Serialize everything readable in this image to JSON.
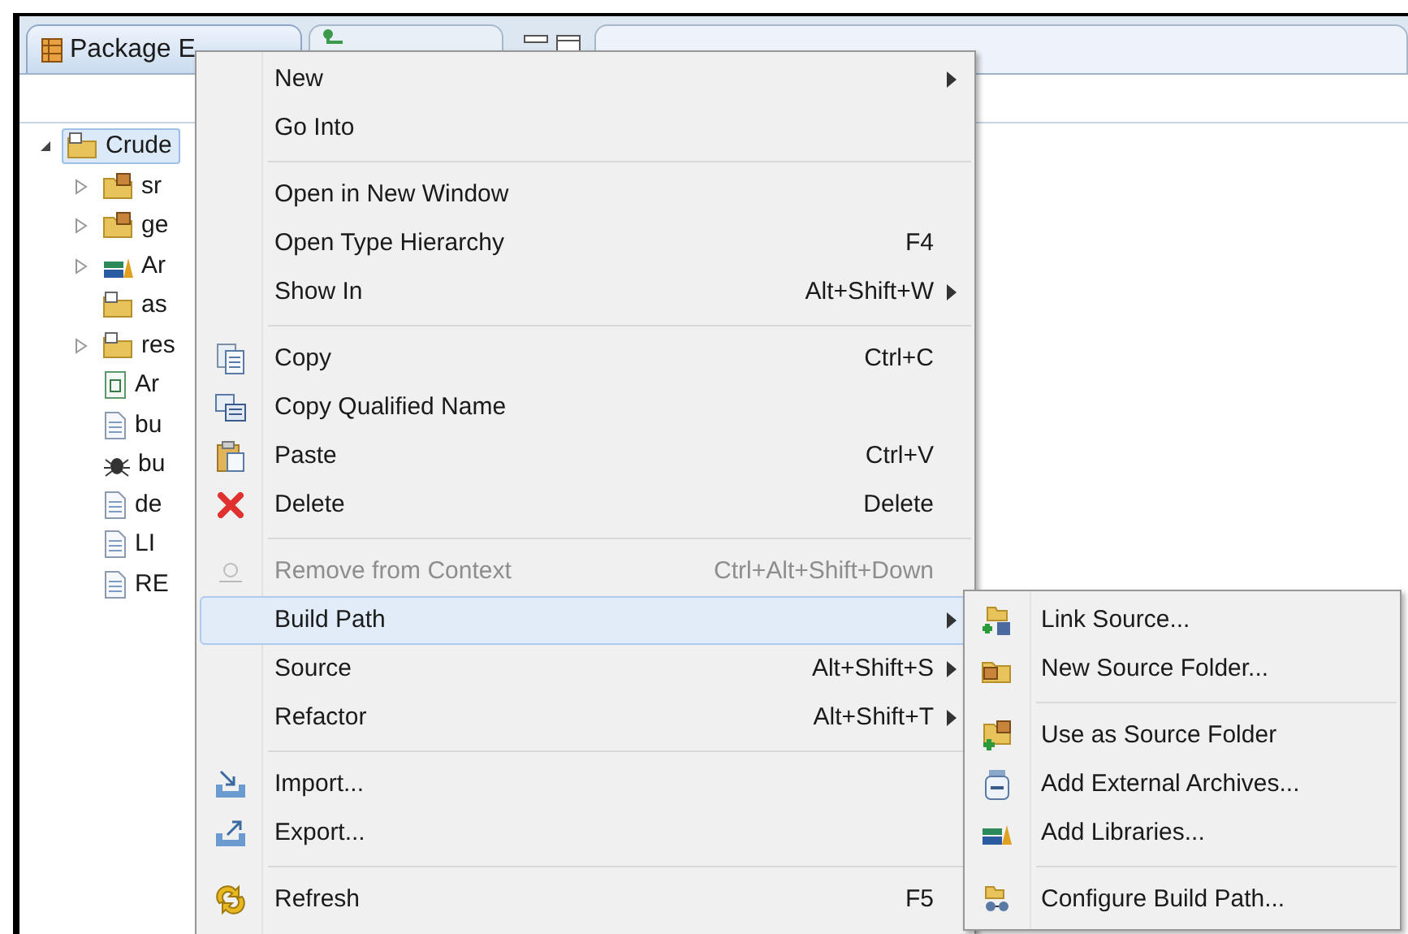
{
  "tabs": [
    {
      "label": "Package E",
      "selected": true
    },
    {
      "selected": false
    }
  ],
  "tree": [
    {
      "label": "Crude",
      "selected": true,
      "expanded": true,
      "children": [
        {
          "label": "sr",
          "expanded": false
        },
        {
          "label": "ge",
          "expanded": false
        },
        {
          "label": "Ar",
          "expanded": false
        },
        {
          "label": "as"
        },
        {
          "label": "res",
          "expanded": false
        },
        {
          "label": "Ar"
        },
        {
          "label": "bu"
        },
        {
          "label": "bu"
        },
        {
          "label": "de"
        },
        {
          "label": "LI"
        },
        {
          "label": "RE"
        }
      ]
    }
  ],
  "context_menu": {
    "items": [
      {
        "kind": "item",
        "label": "New",
        "submenu": true,
        "disabled": false,
        "selected": false
      },
      {
        "kind": "item",
        "label": "Go Into",
        "submenu": false,
        "disabled": false,
        "selected": false
      },
      {
        "kind": "separator"
      },
      {
        "kind": "item",
        "label": "Open in New Window",
        "submenu": false,
        "disabled": false,
        "selected": false
      },
      {
        "kind": "item",
        "label": "Open Type Hierarchy",
        "shortcut": "F4",
        "submenu": false,
        "disabled": false,
        "selected": false
      },
      {
        "kind": "item",
        "label": "Show In",
        "shortcut": "Alt+Shift+W",
        "submenu": true,
        "disabled": false,
        "selected": false
      },
      {
        "kind": "separator"
      },
      {
        "kind": "item",
        "label": "Copy",
        "shortcut": "Ctrl+C",
        "submenu": false,
        "disabled": false,
        "selected": false
      },
      {
        "kind": "item",
        "label": "Copy Qualified Name",
        "submenu": false,
        "disabled": false,
        "selected": false
      },
      {
        "kind": "item",
        "label": "Paste",
        "shortcut": "Ctrl+V",
        "submenu": false,
        "disabled": false,
        "selected": false
      },
      {
        "kind": "item",
        "label": "Delete",
        "shortcut": "Delete",
        "submenu": false,
        "disabled": false,
        "selected": false
      },
      {
        "kind": "separator"
      },
      {
        "kind": "item",
        "label": "Remove from Context",
        "shortcut": "Ctrl+Alt+Shift+Down",
        "submenu": false,
        "disabled": true,
        "selected": false
      },
      {
        "kind": "item",
        "label": "Build Path",
        "submenu": true,
        "disabled": false,
        "selected": true
      },
      {
        "kind": "item",
        "label": "Source",
        "shortcut": "Alt+Shift+S",
        "submenu": true,
        "disabled": false,
        "selected": false
      },
      {
        "kind": "item",
        "label": "Refactor",
        "shortcut": "Alt+Shift+T",
        "submenu": true,
        "disabled": false,
        "selected": false
      },
      {
        "kind": "separator"
      },
      {
        "kind": "item",
        "label": "Import...",
        "submenu": false,
        "disabled": false,
        "selected": false
      },
      {
        "kind": "item",
        "label": "Export...",
        "submenu": false,
        "disabled": false,
        "selected": false
      },
      {
        "kind": "separator"
      },
      {
        "kind": "item",
        "label": "Refresh",
        "shortcut": "F5",
        "submenu": false,
        "disabled": false,
        "selected": false
      }
    ]
  },
  "submenu": {
    "items": [
      {
        "kind": "item",
        "label": "Link Source..."
      },
      {
        "kind": "item",
        "label": "New Source Folder..."
      },
      {
        "kind": "separator"
      },
      {
        "kind": "item",
        "label": "Use as Source Folder"
      },
      {
        "kind": "item",
        "label": "Add External Archives..."
      },
      {
        "kind": "item",
        "label": "Add Libraries..."
      },
      {
        "kind": "separator"
      },
      {
        "kind": "item",
        "label": "Configure Build Path..."
      }
    ]
  }
}
